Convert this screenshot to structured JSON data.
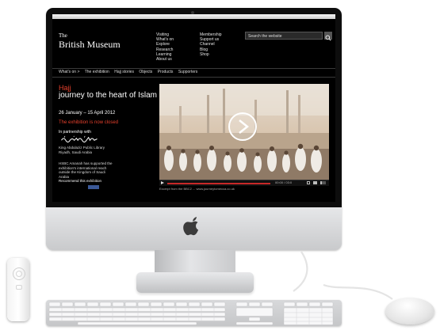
{
  "site": {
    "logo_the": "The",
    "logo_main": "British Museum",
    "nav_col1": [
      "Visiting",
      "What's on",
      "Explore",
      "Research",
      "Learning",
      "About us"
    ],
    "nav_col2": [
      "Membership",
      "Support us",
      "Channel",
      "Blog",
      "Shop"
    ],
    "search_placeholder": "Search the website",
    "subnav": [
      "What's on  >",
      "The exhibition",
      "Hajj stories",
      "Objects",
      "Products",
      "Supporters"
    ]
  },
  "exhibition": {
    "title_line1": "Hajj",
    "title_line2": "journey to the heart of Islam",
    "dates": "26 January – 15 April 2012",
    "closed_notice": "The exhibition is now closed",
    "partnership_label": "In partnership with",
    "library_name": "King Abdulaziz Public Library Riyadh, Saudi Arabia",
    "sponsor_text": "HSBC Amanah has supported the exhibition's international reach outside the Kingdom of Saudi Arabia",
    "recommend_label": "Recommend this exhibition"
  },
  "video": {
    "time": "00:00 / 03:0",
    "caption": "Excerpt from the BBC2 ... www.journeytomecca.co.uk"
  },
  "colors": {
    "accent_red": "#e6402c",
    "screen_bg": "#000000",
    "aluminium": "#d3d4d6"
  },
  "icons": {
    "apple": "apple-logo-icon",
    "play": "play-icon",
    "search": "search-icon"
  }
}
